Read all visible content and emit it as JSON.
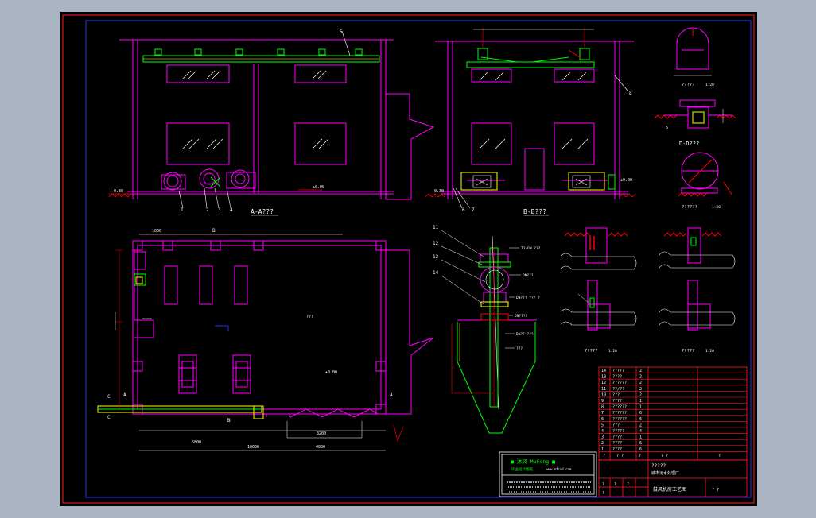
{
  "views": {
    "section_a": {
      "title": "A-A???"
    },
    "section_b": {
      "title": "B-B???"
    },
    "detail_c": {
      "title": "?????",
      "scale": "1:20"
    },
    "detail_d": {
      "title": "D-D???"
    },
    "detail_e": {
      "title": "??????",
      "scale": "1:20"
    },
    "detail_f": {
      "title": "?????",
      "scale": "1:20"
    },
    "detail_g": {
      "title": "?????",
      "scale": "1:20"
    },
    "plan_room": {
      "label": "???"
    }
  },
  "elevations": {
    "floor": "±0.00",
    "ground": "-0.30"
  },
  "dimensions": {
    "overall": "10000",
    "right_part": "4000",
    "left_part": "5800",
    "small": "1000",
    "pit": "3200"
  },
  "axis_marks": {
    "a": "A",
    "b": "B",
    "c": "C"
  },
  "balloons_a": [
    "1",
    "2",
    "3",
    "4",
    "5"
  ],
  "balloons_b": [
    "6",
    "7",
    "8"
  ],
  "balloons_pipe": [
    "11",
    "12",
    "13",
    "14"
  ],
  "pipe_notes": [
    "T1/DN ???",
    "DN???",
    "DN???  ??? ?",
    "DN????",
    "DN?? ???",
    "???"
  ],
  "title_block": {
    "logo": "■ 沐风 MuFeng ■",
    "subtitle": "毕业设计图纸",
    "url": "www.mfcad.com",
    "drawing_title": "?????",
    "project": "城市污水处理厂",
    "drawing_name": "鼓风机房工艺图",
    "sheet": "?  ?",
    "row_labels": [
      "?",
      "?",
      "?",
      "?"
    ]
  },
  "parts_list": [
    {
      "no": "14",
      "name": "?????",
      "qty": "2"
    },
    {
      "no": "13",
      "name": "????",
      "qty": "2"
    },
    {
      "no": "12",
      "name": "??????",
      "qty": "2"
    },
    {
      "no": "11",
      "name": "??/??",
      "qty": "2"
    },
    {
      "no": "10",
      "name": "???",
      "qty": "2"
    },
    {
      "no": "9",
      "name": "????",
      "qty": "1"
    },
    {
      "no": "8",
      "name": "??????",
      "qty": "1"
    },
    {
      "no": "7",
      "name": "??????",
      "qty": "6"
    },
    {
      "no": "6",
      "name": "??????",
      "qty": "6"
    },
    {
      "no": "5",
      "name": "???",
      "qty": "2"
    },
    {
      "no": "4",
      "name": "?????",
      "qty": "4"
    },
    {
      "no": "3",
      "name": "????",
      "qty": "1"
    },
    {
      "no": "2",
      "name": "????",
      "qty": "6"
    },
    {
      "no": "1",
      "name": "????",
      "qty": "6"
    }
  ],
  "parts_header": {
    "no": "?",
    "name": "? ?",
    "spec": "? ?",
    "qty": "?",
    "note": "?"
  },
  "colors": {
    "magenta": "#ff00ff",
    "green": "#00ff00",
    "yellow": "#ffff00",
    "red": "#ff0000",
    "white": "#ffffff",
    "blue": "#2b2bff",
    "cyan": "#00ffff"
  }
}
